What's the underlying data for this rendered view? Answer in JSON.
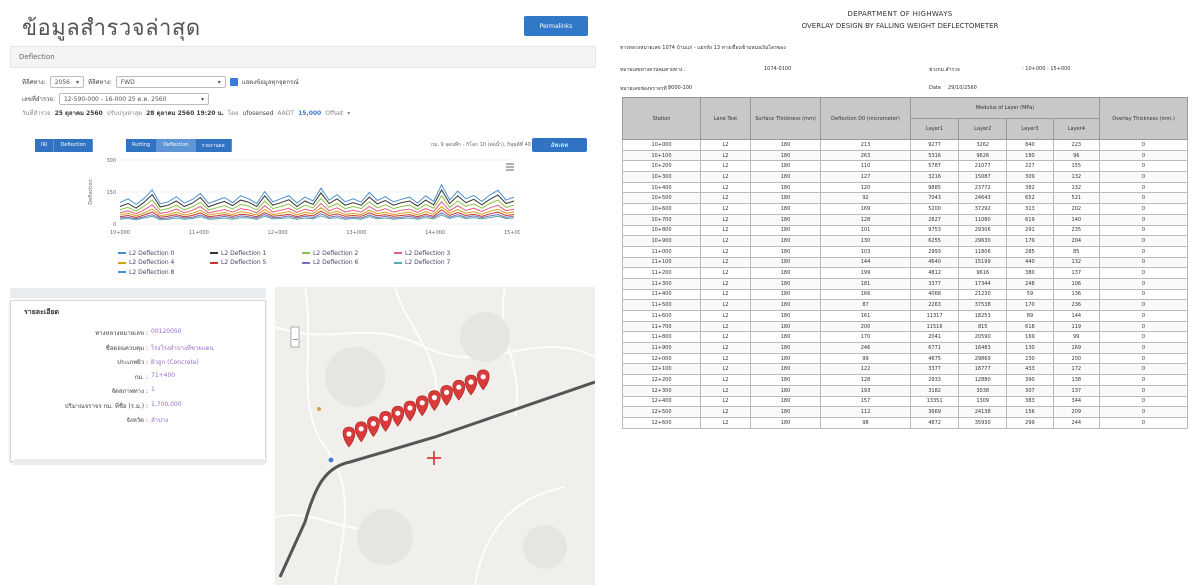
{
  "left": {
    "title": "ข้อมูลสำรวจล่าสุด",
    "report_button": "Permalinks",
    "section": "Deflection",
    "filters": {
      "route_label": "ทีลีศทาง:",
      "route_value": "2056",
      "direction_label": "ทีลีศทาง:",
      "direction_value": "FWD",
      "show_all_label": "แสดงข้อมูลทุกจุดกรณ์",
      "km_label": "เลขที่ลำรวจ:",
      "km_value": "12-590-000 - 16-000 25 ต.ค. 2560",
      "date_prefix": "วันที่สำรวจ",
      "date_value": "25 ตุลาคม 2560",
      "updated_prefix": "ปรับปรุงล่าสุด",
      "updated_value": "28 ตุลาคม 2560 19:20 น.",
      "by_label": "โดย",
      "by_value": "ufosensed",
      "aadt_label": "AADT",
      "aadt_value": "15,000",
      "offset_label": "Offset"
    },
    "tabs": [
      "IRI",
      "Deflection",
      "Rutting",
      "Deflection",
      "รายงานผล"
    ],
    "range_text": "กม. 9 จุดนที่ก - กิโลก 10 (ต่อน้ำ), กิลุมต์ที่ 401",
    "update_button": "อัพเดท"
  },
  "chart_data": {
    "type": "line",
    "x_ticks": [
      "10+000",
      "11+000",
      "12+000",
      "13+000",
      "14+000",
      "15+000"
    ],
    "y_ticks": [
      "300",
      "150",
      "0"
    ],
    "ylabel": "Deflection",
    "ylim": [
      0,
      300
    ],
    "series": [
      {
        "name": "L2 Deflection 0",
        "color": "#4a8fd0",
        "values": [
          100,
          118,
          92,
          120,
          160,
          95,
          104,
          128,
          98,
          115,
          143,
          97,
          110,
          124,
          100,
          132,
          118,
          96,
          152,
          104,
          118,
          133,
          98,
          126,
          108,
          168,
          112,
          138,
          104,
          118,
          102,
          148,
          110,
          128,
          104,
          116,
          126,
          98,
          132,
          106,
          184,
          112,
          154,
          118,
          134,
          106,
          136,
          158,
          112,
          126
        ]
      },
      {
        "name": "L2 Deflection 1",
        "color": "#333333",
        "values": [
          82,
          96,
          74,
          102,
          138,
          80,
          88,
          108,
          82,
          98,
          124,
          80,
          94,
          106,
          86,
          112,
          102,
          82,
          132,
          88,
          100,
          114,
          82,
          108,
          92,
          146,
          96,
          118,
          88,
          100,
          88,
          126,
          94,
          110,
          88,
          100,
          108,
          84,
          112,
          90,
          160,
          96,
          132,
          100,
          116,
          90,
          116,
          136,
          96,
          108
        ]
      },
      {
        "name": "L2 Deflection 2",
        "color": "#8bc34a",
        "values": [
          66,
          78,
          60,
          84,
          112,
          64,
          72,
          88,
          66,
          80,
          102,
          66,
          76,
          86,
          70,
          92,
          84,
          66,
          108,
          72,
          82,
          94,
          68,
          88,
          76,
          120,
          78,
          96,
          72,
          82,
          72,
          104,
          76,
          90,
          72,
          82,
          88,
          68,
          92,
          74,
          132,
          78,
          108,
          82,
          94,
          74,
          96,
          112,
          78,
          88
        ]
      },
      {
        "name": "L2 Deflection 3",
        "color": "#e05c8a",
        "values": [
          52,
          62,
          48,
          66,
          90,
          50,
          56,
          70,
          52,
          64,
          82,
          52,
          60,
          68,
          56,
          72,
          66,
          52,
          86,
          56,
          64,
          74,
          54,
          70,
          60,
          96,
          62,
          76,
          56,
          64,
          56,
          82,
          60,
          72,
          56,
          64,
          70,
          54,
          72,
          58,
          104,
          62,
          86,
          64,
          74,
          58,
          76,
          88,
          62,
          70
        ]
      },
      {
        "name": "L2 Deflection 4",
        "color": "#d4a017",
        "values": [
          42,
          50,
          38,
          52,
          70,
          40,
          44,
          56,
          42,
          50,
          64,
          42,
          48,
          54,
          44,
          58,
          52,
          42,
          68,
          44,
          50,
          58,
          42,
          56,
          48,
          76,
          50,
          60,
          44,
          50,
          44,
          64,
          48,
          56,
          44,
          50,
          56,
          42,
          58,
          46,
          82,
          50,
          68,
          50,
          58,
          46,
          60,
          70,
          50,
          56
        ]
      },
      {
        "name": "L2 Deflection 5",
        "color": "#c0392b",
        "values": [
          34,
          40,
          30,
          42,
          56,
          32,
          36,
          44,
          34,
          40,
          52,
          34,
          38,
          44,
          36,
          46,
          42,
          34,
          54,
          36,
          40,
          46,
          34,
          44,
          38,
          60,
          40,
          48,
          36,
          40,
          36,
          52,
          38,
          44,
          36,
          40,
          44,
          34,
          46,
          36,
          66,
          40,
          54,
          40,
          46,
          36,
          48,
          56,
          40,
          44
        ]
      },
      {
        "name": "L2 Deflection 6",
        "color": "#7a6fc1",
        "values": [
          28,
          32,
          24,
          34,
          44,
          26,
          28,
          36,
          28,
          32,
          42,
          28,
          30,
          36,
          28,
          38,
          34,
          28,
          44,
          30,
          32,
          38,
          28,
          36,
          30,
          48,
          32,
          38,
          28,
          32,
          28,
          42,
          30,
          36,
          28,
          32,
          36,
          28,
          38,
          30,
          52,
          32,
          44,
          32,
          38,
          30,
          38,
          44,
          32,
          36
        ]
      },
      {
        "name": "L2 Deflection 7",
        "color": "#5aa8a8",
        "values": [
          22,
          26,
          20,
          28,
          36,
          20,
          22,
          28,
          22,
          26,
          34,
          22,
          24,
          28,
          22,
          30,
          28,
          22,
          36,
          24,
          26,
          30,
          22,
          28,
          24,
          38,
          26,
          30,
          22,
          26,
          22,
          34,
          24,
          28,
          22,
          26,
          28,
          22,
          30,
          24,
          42,
          26,
          36,
          26,
          30,
          24,
          30,
          36,
          26,
          28
        ]
      }
    ],
    "legend_rows": [
      [
        "L2 Deflection 0",
        "L2 Deflection 1",
        "L2 Deflection 2",
        "L2 Deflection 3"
      ],
      [
        "L2 Deflection 4",
        "L2 Deflection 5",
        "L2 Deflection 6",
        "L2 Deflection 7"
      ],
      [
        "L2 Deflection 8"
      ]
    ]
  },
  "info": {
    "title": "รายละเอียด",
    "rows": [
      {
        "k": "ทางหลวงหมายเลข :",
        "v": "00120050"
      },
      {
        "k": "ชื่อตอนควบคุม :",
        "v": "โรงโรงลำปางที่ชายแดน"
      },
      {
        "k": "ประเภทผิว :",
        "v": "ผิวลูก (Concrete)"
      },
      {
        "k": "กม. :",
        "v": "71+400"
      },
      {
        "k": "จัดสภาพทาง :",
        "v": "1"
      },
      {
        "k": "ปริมาณจราจร กม. ที่ชื่อ (ร.ม.) :",
        "v": "1,700,000"
      },
      {
        "k": "จังหวัด :",
        "v": "ลำปาง"
      }
    ]
  },
  "right": {
    "dept": "DEPARTMENT OF HIGHWAYS",
    "subtitle": "OVERLAY DESIGN BY FALLING WEIGHT DEFLECTOMETER",
    "route_line": "ทางหลวงหมายเลข 1074 บ้านแก่ - แยกห้ง 13 ทางเขื่อนข้ามหมอเงินไดรของ",
    "control_label": "หมายเลขทางควบคุมสายทาง :",
    "control_value": "1074-0100",
    "span_label": "ช่วงกม.สำรวจ",
    "span_value": ": 10+000 - 15+000",
    "lane_label": "หมายเลขช่องจราจรที่ :",
    "lane_value": "8000-100",
    "date_label": "Date",
    "date_value": "29/10/2560",
    "headers": {
      "station": "Station",
      "lane": "Lane Test",
      "surface": "Surface Thickness (mm)",
      "deflection": "Deflection D0 (micrometer)",
      "modulus": "Modulus of Layer (MPa)",
      "layers": [
        "Layer1",
        "Layer2",
        "Layer3",
        "Layer4"
      ],
      "overlay": "Overlay Thickness (mm.)"
    },
    "rows": [
      [
        "10+000",
        "L2",
        "180",
        "213",
        "9277",
        "3262",
        "840",
        "223",
        "0"
      ],
      [
        "10+100",
        "L2",
        "180",
        "263",
        "5316",
        "9626",
        "180",
        "96",
        "0"
      ],
      [
        "10+200",
        "L2",
        "180",
        "110",
        "5787",
        "21077",
        "227",
        "155",
        "0"
      ],
      [
        "10+300",
        "L2",
        "180",
        "127",
        "3216",
        "15087",
        "309",
        "132",
        "0"
      ],
      [
        "10+400",
        "L2",
        "180",
        "120",
        "9885",
        "23772",
        "382",
        "132",
        "0"
      ],
      [
        "10+500",
        "L2",
        "180",
        "92",
        "7043",
        "24643",
        "652",
        "521",
        "0"
      ],
      [
        "10+600",
        "L2",
        "180",
        "169",
        "5200",
        "37292",
        "313",
        "202",
        "0"
      ],
      [
        "10+700",
        "L2",
        "180",
        "128",
        "2827",
        "11080",
        "619",
        "140",
        "0"
      ],
      [
        "10+800",
        "L2",
        "180",
        "101",
        "9753",
        "29306",
        "291",
        "235",
        "0"
      ],
      [
        "10+900",
        "L2",
        "180",
        "130",
        "6255",
        "29630",
        "179",
        "204",
        "0"
      ],
      [
        "11+000",
        "L2",
        "180",
        "103",
        "2993",
        "11806",
        "285",
        "85",
        "0"
      ],
      [
        "11+100",
        "L2",
        "180",
        "144",
        "4640",
        "15199",
        "440",
        "132",
        "0"
      ],
      [
        "11+200",
        "L2",
        "180",
        "199",
        "4812",
        "9616",
        "380",
        "137",
        "0"
      ],
      [
        "11+300",
        "L2",
        "180",
        "181",
        "3377",
        "17344",
        "248",
        "106",
        "0"
      ],
      [
        "11+400",
        "L2",
        "180",
        "166",
        "4068",
        "21230",
        "59",
        "136",
        "0"
      ],
      [
        "11+500",
        "L2",
        "180",
        "87",
        "2263",
        "37538",
        "170",
        "236",
        "0"
      ],
      [
        "11+600",
        "L2",
        "180",
        "161",
        "11317",
        "18253",
        "89",
        "144",
        "0"
      ],
      [
        "11+700",
        "L2",
        "180",
        "200",
        "11516",
        "815",
        "618",
        "119",
        "0"
      ],
      [
        "11+800",
        "L2",
        "180",
        "170",
        "2041",
        "20590",
        "169",
        "99",
        "0"
      ],
      [
        "11+900",
        "L2",
        "180",
        "246",
        "6771",
        "16483",
        "130",
        "169",
        "0"
      ],
      [
        "12+000",
        "L2",
        "180",
        "99",
        "4675",
        "29869",
        "230",
        "200",
        "0"
      ],
      [
        "12+100",
        "L2",
        "180",
        "122",
        "3377",
        "18777",
        "433",
        "172",
        "0"
      ],
      [
        "12+200",
        "L2",
        "180",
        "128",
        "2933",
        "12880",
        "390",
        "138",
        "0"
      ],
      [
        "12+300",
        "L2",
        "180",
        "193",
        "3182",
        "3038",
        "307",
        "137",
        "0"
      ],
      [
        "12+400",
        "L2",
        "180",
        "157",
        "13351",
        "1309",
        "383",
        "344",
        "0"
      ],
      [
        "12+500",
        "L2",
        "180",
        "112",
        "3669",
        "24138",
        "156",
        "209",
        "0"
      ],
      [
        "12+600",
        "L2",
        "180",
        "98",
        "4872",
        "35930",
        "299",
        "244",
        "0"
      ]
    ]
  }
}
